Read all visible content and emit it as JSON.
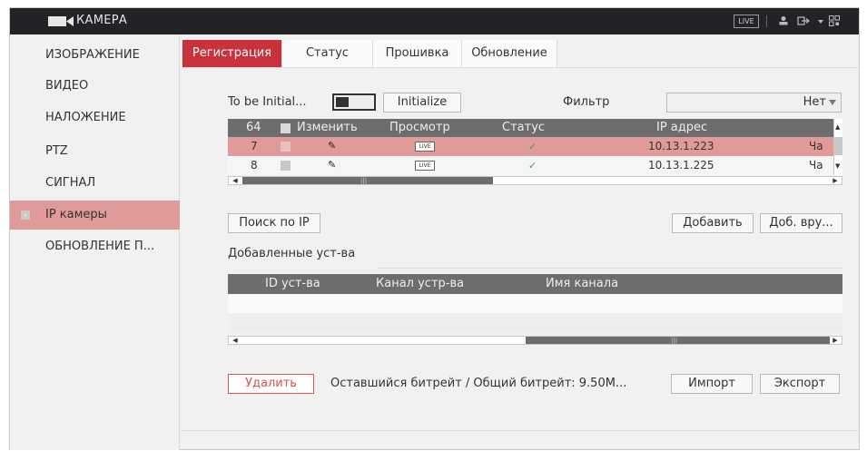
{
  "header": {
    "title": "КАМЕРА",
    "live_label": "LIVE"
  },
  "sidebar": {
    "items": [
      {
        "label": "ИЗОБРАЖЕНИЕ"
      },
      {
        "label": "ВИДЕО"
      },
      {
        "label": "НАЛОЖЕНИЕ"
      },
      {
        "label": "PTZ"
      },
      {
        "label": "СИГНАЛ"
      },
      {
        "label": "IP камеры"
      },
      {
        "label": "ОБНОВЛЕНИЕ П..."
      }
    ]
  },
  "tabs": [
    {
      "label": "Регистрация"
    },
    {
      "label": "Статус"
    },
    {
      "label": "Прошивка"
    },
    {
      "label": "Обновление"
    }
  ],
  "controls": {
    "to_be_initialized_label": "To be Initial...",
    "initialize_button": "Initialize",
    "filter_label": "Фильтр",
    "filter_value": "Нет"
  },
  "device_table": {
    "headers": {
      "count": "64",
      "edit": "Изменить",
      "view": "Просмотр",
      "status": "Статус",
      "ip": "IP адрес"
    },
    "rows": [
      {
        "num": "7",
        "live": "LIVE",
        "ip": "10.13.1.223",
        "extra": "Ча"
      },
      {
        "num": "8",
        "live": "LIVE",
        "ip": "10.13.1.225",
        "extra": "Ча"
      }
    ]
  },
  "buttons": {
    "search_ip": "Поиск по IP",
    "add": "Добавить",
    "add_manual": "Доб. вру...",
    "delete": "Удалить",
    "import": "Импорт",
    "export": "Экспорт"
  },
  "added_section": {
    "title": "Добавленные уст-ва",
    "headers": {
      "device_id": "ID уст-ва",
      "device_channel": "Канал устр-ва",
      "channel_name": "Имя канала"
    }
  },
  "bitrate_text": "Оставшийся битрейт / Общий битрейт: 9.50M...",
  "colors": {
    "accent": "#c8323a",
    "active_row": "#e09a9a",
    "header_bar": "#222326",
    "table_header": "#6d6d6d"
  }
}
